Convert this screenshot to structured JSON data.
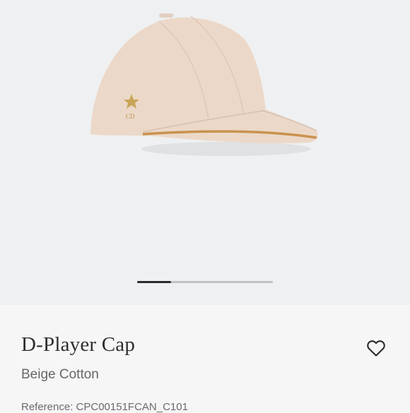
{
  "product": {
    "name": "D-Player Cap",
    "variant": "Beige Cotton",
    "reference": "Reference: CPC00151FCAN_C101",
    "image_alt": "Beige cotton baseball cap with gold star CD emblem",
    "emblem_text": "CD"
  },
  "gallery": {
    "progress": 0.25
  },
  "icons": {
    "wishlist": "heart-outline-icon"
  },
  "colors": {
    "cap": "#ecd8c8",
    "trim": "#c9924f",
    "accent_gold": "#c8a558"
  }
}
